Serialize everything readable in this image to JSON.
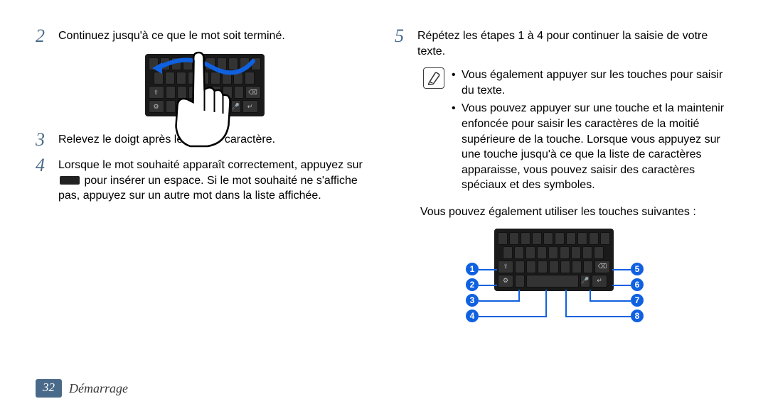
{
  "steps": {
    "s2_num": "2",
    "s2_text": "Continuez jusqu'à ce que le mot soit terminé.",
    "s3_num": "3",
    "s3_text": "Relevez le doigt après le dernier caractère.",
    "s4_num": "4",
    "s4_text_a": "Lorsque le mot souhaité apparaît correctement, appuyez sur",
    "s4_text_b": "pour insérer un espace. Si le mot souhaité ne s'affiche pas, appuyez sur un autre mot dans la liste affichée.",
    "s5_num": "5",
    "s5_text": "Répétez les étapes 1 à 4 pour continuer la saisie de votre texte."
  },
  "notes": {
    "n1": "Vous également appuyer sur les touches pour saisir du texte.",
    "n2": "Vous pouvez appuyer sur une touche et la maintenir enfoncée pour saisir les caractères de la moitié supérieure de la touche. Lorsque vous appuyez sur une touche jusqu'à ce que la liste de caractères apparaisse, vous pouvez saisir des caractères spéciaux et des symboles."
  },
  "after_notes": "Vous pouvez également utiliser les touches suivantes :",
  "footer": {
    "page": "32",
    "section": "Démarrage"
  },
  "callouts": {
    "c1": "1",
    "c2": "2",
    "c3": "3",
    "c4": "4",
    "c5": "5",
    "c6": "6",
    "c7": "7",
    "c8": "8"
  },
  "bullet_glyph": "•"
}
